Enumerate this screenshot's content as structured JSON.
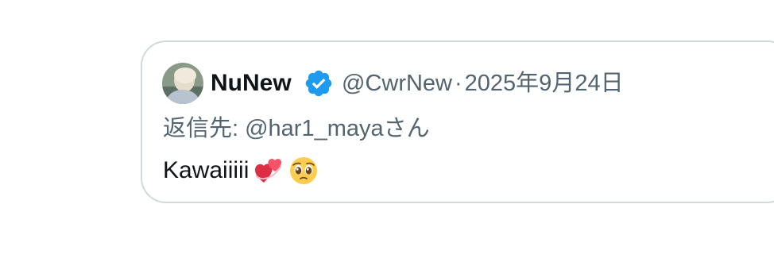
{
  "tweet": {
    "display_name": "NuNew",
    "handle": "@CwrNew",
    "separator": "·",
    "date": "2025年9月24日",
    "reply_to": "返信先: @har1_mayaさん",
    "text": "Kawaiiiii",
    "emojis": [
      "two-hearts-emoji",
      "pleading-face-emoji"
    ],
    "icons": {
      "verified": "verified-badge-icon"
    },
    "colors": {
      "verified_blue": "#1d9bf0",
      "text_primary": "#0f1419",
      "text_secondary": "#536471",
      "border": "#cfd9de"
    }
  }
}
